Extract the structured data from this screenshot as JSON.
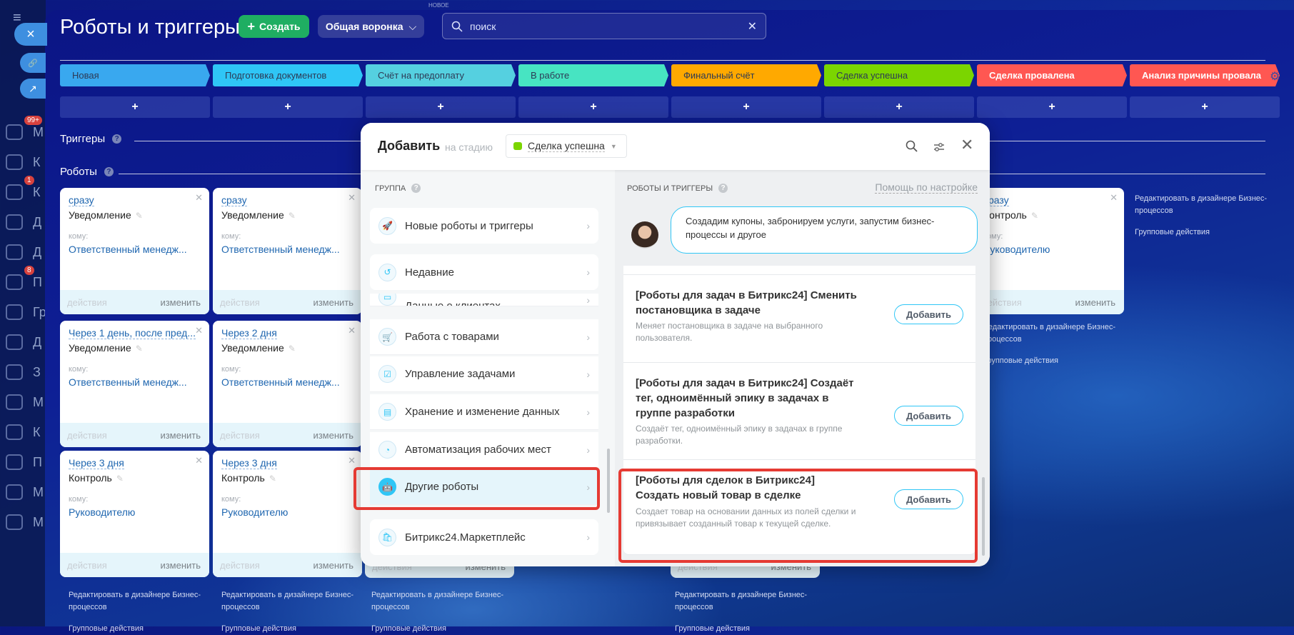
{
  "topbar": {
    "new_label": "НОВОЕ"
  },
  "sidebar": {
    "close_icon": "×",
    "link_icon": "🔗",
    "open_icon": "↗",
    "items": [
      {
        "letter": "М",
        "badge": "99+"
      },
      {
        "letter": "К",
        "badge": ""
      },
      {
        "letter": "К",
        "badge": "1"
      },
      {
        "letter": "Д",
        "badge": ""
      },
      {
        "letter": "Д",
        "badge": ""
      },
      {
        "letter": "П",
        "badge": "8"
      },
      {
        "letter": "Гр",
        "badge": ""
      },
      {
        "letter": "Д",
        "badge": ""
      },
      {
        "letter": "З",
        "badge": ""
      },
      {
        "letter": "М",
        "badge": ""
      },
      {
        "letter": "К",
        "badge": ""
      },
      {
        "letter": "П",
        "badge": ""
      },
      {
        "letter": "М",
        "badge": ""
      },
      {
        "letter": "М",
        "badge": ""
      }
    ]
  },
  "header": {
    "title": "Роботы и триггеры",
    "create_label": "Создать",
    "funnel_label": "Общая воронка",
    "search_placeholder": "поиск"
  },
  "stages": [
    {
      "label": "Новая",
      "color": "#39a8ef",
      "text": "#2d3a55"
    },
    {
      "label": "Подготовка документов",
      "color": "#2fc6f6",
      "text": "#2d3a55"
    },
    {
      "label": "Счёт на предоплату",
      "color": "#55d0e0",
      "text": "#2d3a55"
    },
    {
      "label": "В работе",
      "color": "#47e4c2",
      "text": "#2d3a55"
    },
    {
      "label": "Финальный счёт",
      "color": "#ffa900",
      "text": "#2d3a55"
    },
    {
      "label": "Сделка успешна",
      "color": "#7bd500",
      "text": "#2d3a55"
    },
    {
      "label": "Сделка провалена",
      "color": "#ff5752",
      "text": "#ffffff"
    },
    {
      "label": "Анализ причины провала",
      "color": "#ff5752",
      "text": "#ffffff"
    }
  ],
  "sections": {
    "triggers": "Триггеры",
    "robots": "Роботы"
  },
  "cards": {
    "to_label": "кому:",
    "actions_label": "действия",
    "edit_label": "изменить",
    "col1": [
      {
        "delay": "сразу",
        "name": "Уведомление",
        "who": "Ответственный менедж..."
      },
      {
        "delay": "Через 1 день, после пред...",
        "name": "Уведомление",
        "who": "Ответственный менедж..."
      },
      {
        "delay": "Через 3 дня",
        "name": "Контроль",
        "who": "Руководителю"
      }
    ],
    "col2": [
      {
        "delay": "сразу",
        "name": "Уведомление",
        "who": "Ответственный менедж..."
      },
      {
        "delay": "Через 2 дня",
        "name": "Уведомление",
        "who": "Ответственный менедж..."
      },
      {
        "delay": "Через 3 дня",
        "name": "Контроль",
        "who": "Руководителю"
      }
    ],
    "col7": {
      "delay": "сразу",
      "name": "Контроль",
      "who": "Руководителю"
    }
  },
  "links": {
    "edit_designer": "Редактировать в дизайнере Бизнес-процессов",
    "group_actions": "Групповые действия"
  },
  "modal": {
    "title": "Добавить",
    "stage_prefix": "на стадию",
    "stage_value": "Сделка успешна",
    "stage_color": "#7bd500",
    "group_header": "ГРУППА",
    "robots_header": "РОБОТЫ И ТРИГГЕРЫ",
    "help_link": "Помощь по настройке",
    "bubble_text": "Создадим купоны, забронируем услуги, запустим бизнес-процессы и другое",
    "groups": [
      "Новые роботы и триггеры",
      "Недавние",
      "Данные о клиентах",
      "Работа с товарами",
      "Управление задачами",
      "Хранение и изменение данных",
      "Автоматизация рабочих мест",
      "Другие роботы",
      "Битрикс24.Маркетплейс"
    ],
    "add_label": "Добавить",
    "robots": [
      {
        "title": "[Роботы для задач в Битрикс24] Сменить постановщика в задаче",
        "desc": "Меняет постановщика в задаче на выбранного пользователя."
      },
      {
        "title": "[Роботы для задач в Битрикс24] Создаёт тег, одноимённый эпику в задачах в группе разработки",
        "desc": "Создаёт тег, одноимённый эпику в задачах в группе разработки."
      },
      {
        "title": "[Роботы для сделок в Битрикс24] Создать новый товар в сделке",
        "desc": "Создает товар на основании данных из полей сделки и привязывает созданный товар к текущей сделке."
      }
    ]
  }
}
